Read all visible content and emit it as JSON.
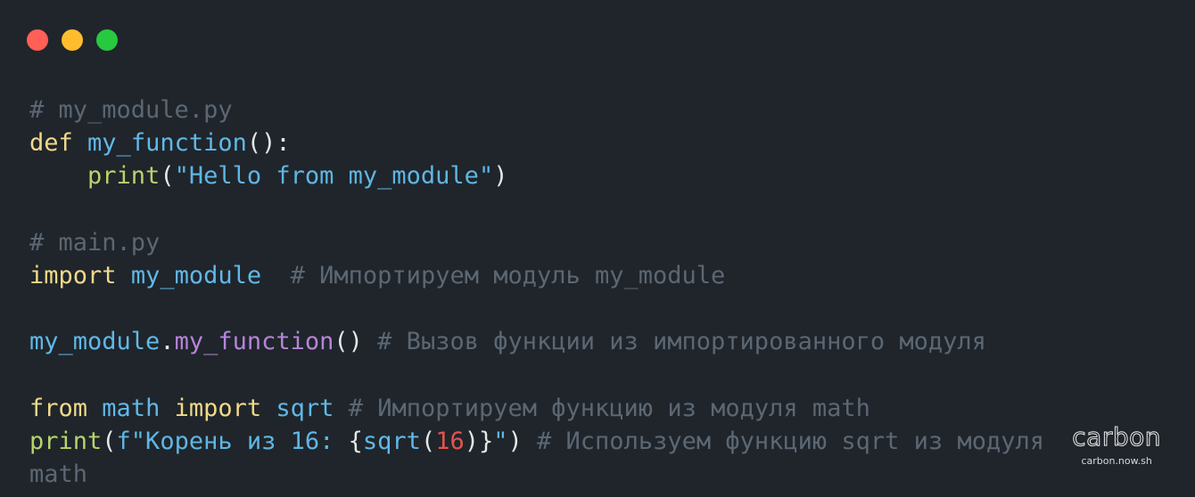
{
  "colors": {
    "background": "#1f252b",
    "dot_close": "#ff5f56",
    "dot_minimize": "#ffbd2e",
    "dot_maximize": "#27c93f",
    "comment": "#5c6773",
    "keyword": "#f2d98a",
    "function": "#61b8e8",
    "builtin": "#b8d36a",
    "string": "#5fb6e3",
    "method": "#b784d9",
    "number": "#e5534b",
    "punctuation": "#e6e6e6"
  },
  "code": {
    "lines": [
      [
        {
          "text": "# my_module.py",
          "type": "comment"
        }
      ],
      [
        {
          "text": "def",
          "type": "keyword"
        },
        {
          "text": " ",
          "type": "plain"
        },
        {
          "text": "my_function",
          "type": "function"
        },
        {
          "text": "():",
          "type": "punctuation"
        }
      ],
      [
        {
          "text": "    ",
          "type": "plain"
        },
        {
          "text": "print",
          "type": "builtin"
        },
        {
          "text": "(",
          "type": "punctuation"
        },
        {
          "text": "\"Hello from my_module\"",
          "type": "string"
        },
        {
          "text": ")",
          "type": "punctuation"
        }
      ],
      [],
      [
        {
          "text": "# main.py",
          "type": "comment"
        }
      ],
      [
        {
          "text": "import",
          "type": "keyword"
        },
        {
          "text": " ",
          "type": "plain"
        },
        {
          "text": "my_module",
          "type": "function"
        },
        {
          "text": "  ",
          "type": "plain"
        },
        {
          "text": "# Импортируем модуль my_module",
          "type": "comment"
        }
      ],
      [],
      [
        {
          "text": "my_module",
          "type": "function"
        },
        {
          "text": ".",
          "type": "punctuation"
        },
        {
          "text": "my_function",
          "type": "method"
        },
        {
          "text": "()",
          "type": "punctuation"
        },
        {
          "text": " ",
          "type": "plain"
        },
        {
          "text": "# Вызов функции из импортированного модуля",
          "type": "comment"
        }
      ],
      [],
      [
        {
          "text": "from",
          "type": "keyword"
        },
        {
          "text": " ",
          "type": "plain"
        },
        {
          "text": "math",
          "type": "function"
        },
        {
          "text": " ",
          "type": "plain"
        },
        {
          "text": "import",
          "type": "keyword"
        },
        {
          "text": " ",
          "type": "plain"
        },
        {
          "text": "sqrt",
          "type": "function"
        },
        {
          "text": " ",
          "type": "plain"
        },
        {
          "text": "# Импортируем функцию из модуля math",
          "type": "comment"
        }
      ],
      [
        {
          "text": "print",
          "type": "builtin"
        },
        {
          "text": "(",
          "type": "punctuation"
        },
        {
          "text": "f\"Корень из 16: ",
          "type": "string"
        },
        {
          "text": "{",
          "type": "punctuation"
        },
        {
          "text": "sqrt",
          "type": "function"
        },
        {
          "text": "(",
          "type": "punctuation"
        },
        {
          "text": "16",
          "type": "number"
        },
        {
          "text": ")}",
          "type": "punctuation"
        },
        {
          "text": "\"",
          "type": "string"
        },
        {
          "text": ")",
          "type": "punctuation"
        },
        {
          "text": " ",
          "type": "plain"
        },
        {
          "text": "# Используем функцию sqrt из модуля",
          "type": "comment"
        }
      ],
      [
        {
          "text": "math",
          "type": "comment"
        }
      ]
    ]
  },
  "watermark": {
    "title": "carbon",
    "subtitle": "carbon.now.sh"
  }
}
